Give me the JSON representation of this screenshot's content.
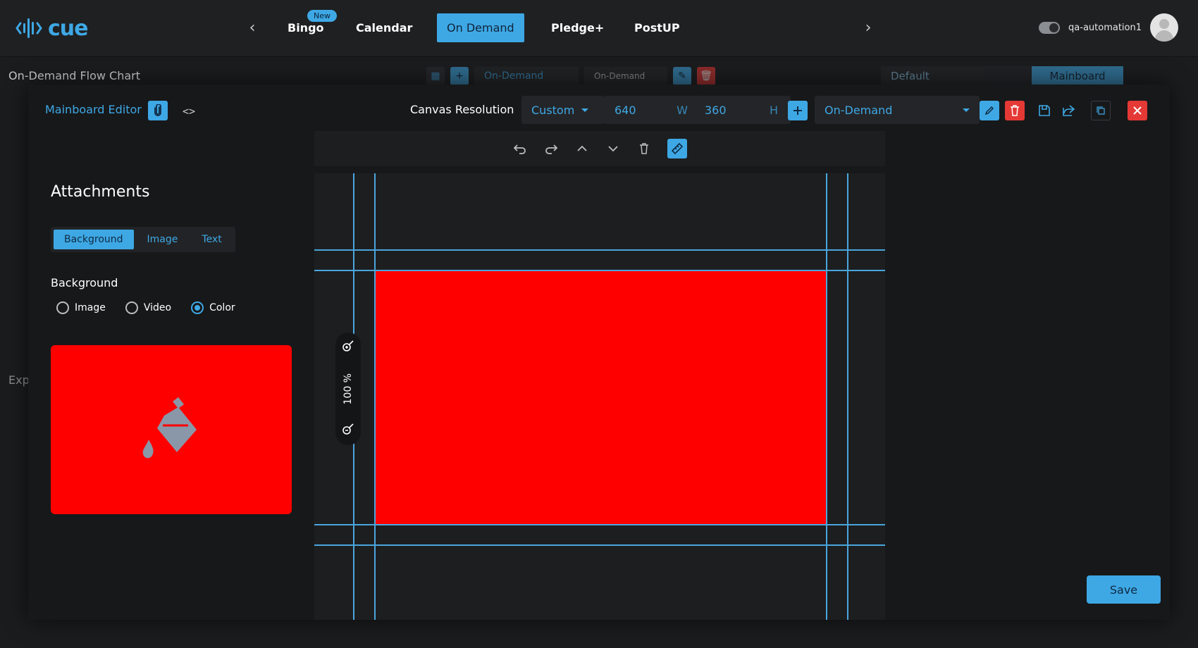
{
  "topnav": {
    "logo_text": "cue",
    "tabs": [
      {
        "label": "Bingo",
        "badge": "New"
      },
      {
        "label": "Calendar"
      },
      {
        "label": "On Demand",
        "active": true
      },
      {
        "label": "Pledge+"
      },
      {
        "label": "PostUP"
      }
    ],
    "username": "qa-automation1"
  },
  "background_page": {
    "title": "On-Demand Flow Chart",
    "exp_text": "Exp",
    "toolbar_select_1": "On-Demand",
    "toolbar_select_2": "On-Demand",
    "default_select": "Default",
    "mainboard_button": "Mainboard"
  },
  "modal": {
    "title": "Mainboard Editor",
    "canvas_resolution_label": "Canvas Resolution",
    "resolution_preset": "Custom",
    "width_value": "640",
    "width_suffix": "W",
    "height_value": "360",
    "height_suffix": "H",
    "flow_select": "On-Demand",
    "attachments_title": "Attachments",
    "segments": [
      "Background",
      "Image",
      "Text"
    ],
    "active_segment": "Background",
    "background_label": "Background",
    "radio_options": [
      "Image",
      "Video",
      "Color"
    ],
    "selected_radio": "Color",
    "selected_color": "#ff0000",
    "zoom": "100 %",
    "save_label": "Save"
  },
  "colors": {
    "accent": "#3ea8e5",
    "danger": "#e53935",
    "canvas_fill": "#ff0000"
  }
}
